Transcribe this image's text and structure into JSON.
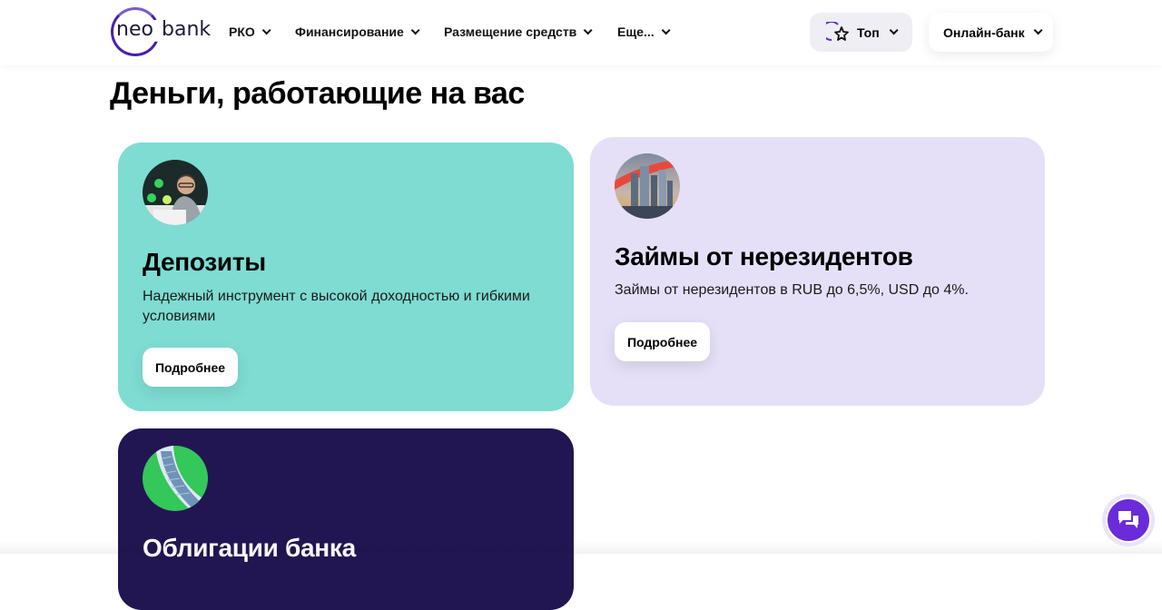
{
  "header": {
    "logo": {
      "left": "neo",
      "right": "bank"
    },
    "nav": [
      {
        "label": "РКО"
      },
      {
        "label": "Финансирование"
      },
      {
        "label": "Размещение средств"
      },
      {
        "label": "Еще..."
      }
    ],
    "top_button": {
      "label": "Топ",
      "icon": "star-icon"
    },
    "online_bank_button": {
      "label": "Онлайн-банк"
    }
  },
  "main": {
    "title": "Деньги, работающие на вас",
    "cards": [
      {
        "title": "Депозиты",
        "description": "Надежный инструмент с высокой доходностью и гибкими условиями",
        "button": "Подробнее",
        "color": "#7edcd2"
      },
      {
        "title": "Займы от нерезидентов",
        "description": "Займы от нерезидентов в RUB до 6,5%, USD до 4%.",
        "button": "Подробнее",
        "color": "#e5e0f8"
      },
      {
        "title": "Облигации банка",
        "color": "#221652"
      }
    ]
  },
  "chat": {
    "icon": "chat-icon"
  },
  "colors": {
    "brand": "#4b1fa6",
    "chat": "#6a2bd9"
  }
}
